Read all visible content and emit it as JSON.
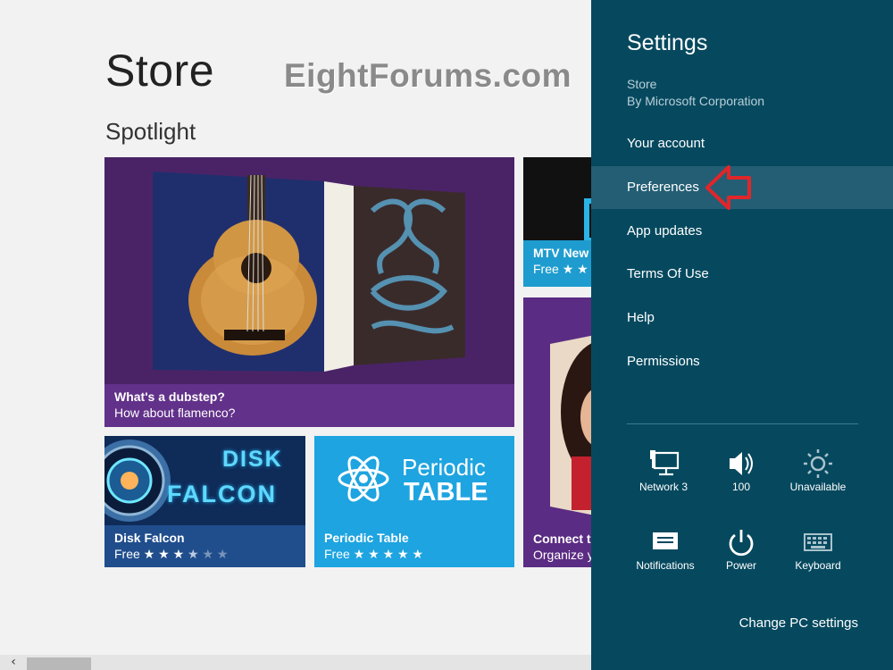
{
  "store": {
    "title": "Store",
    "watermark": "EightForums.com",
    "section": "Spotlight",
    "tiles": {
      "dubstep": {
        "title": "What's a dubstep?",
        "subtitle": "How about flamenco?"
      },
      "mtv": {
        "title": "MTV New",
        "price": "Free",
        "stars": "★ ★"
      },
      "connect": {
        "title": "Connect t",
        "subtitle": "Organize y"
      },
      "disk": {
        "art_line1": "DISK",
        "art_line2": "FALCON",
        "title": "Disk Falcon",
        "price": "Free",
        "stars_full": "★ ★ ★",
        "stars_half": "★",
        "stars_empty": "★ ★",
        "rating": 3.5
      },
      "periodic": {
        "art_line1": "Periodic",
        "art_line2": "TABLE",
        "title": "Periodic Table",
        "price": "Free",
        "stars_full": "★ ★ ★ ★ ★",
        "rating": 5
      }
    },
    "scroll_left": "‹"
  },
  "settings": {
    "title": "Settings",
    "app_name": "Store",
    "app_publisher": "By Microsoft Corporation",
    "menu": [
      {
        "label": "Your account"
      },
      {
        "label": "Preferences",
        "selected": true
      },
      {
        "label": "App updates"
      },
      {
        "label": "Terms Of Use"
      },
      {
        "label": "Help"
      },
      {
        "label": "Permissions"
      }
    ],
    "tray": {
      "network": {
        "label": "Network",
        "value": "3",
        "icon": "network-icon"
      },
      "volume": {
        "label": "100",
        "icon": "speaker-icon"
      },
      "brightness": {
        "label": "Unavailable",
        "icon": "brightness-icon"
      },
      "notifications": {
        "label": "Notifications",
        "icon": "notifications-icon"
      },
      "power": {
        "label": "Power",
        "icon": "power-icon"
      },
      "keyboard": {
        "label": "Keyboard",
        "icon": "keyboard-icon"
      }
    },
    "change_pc": "Change PC settings"
  },
  "colors": {
    "charm_bg": "#06495f",
    "charm_selected": "#235e74",
    "arrow": "#e0262a",
    "store_bg": "#f2f2f2"
  }
}
